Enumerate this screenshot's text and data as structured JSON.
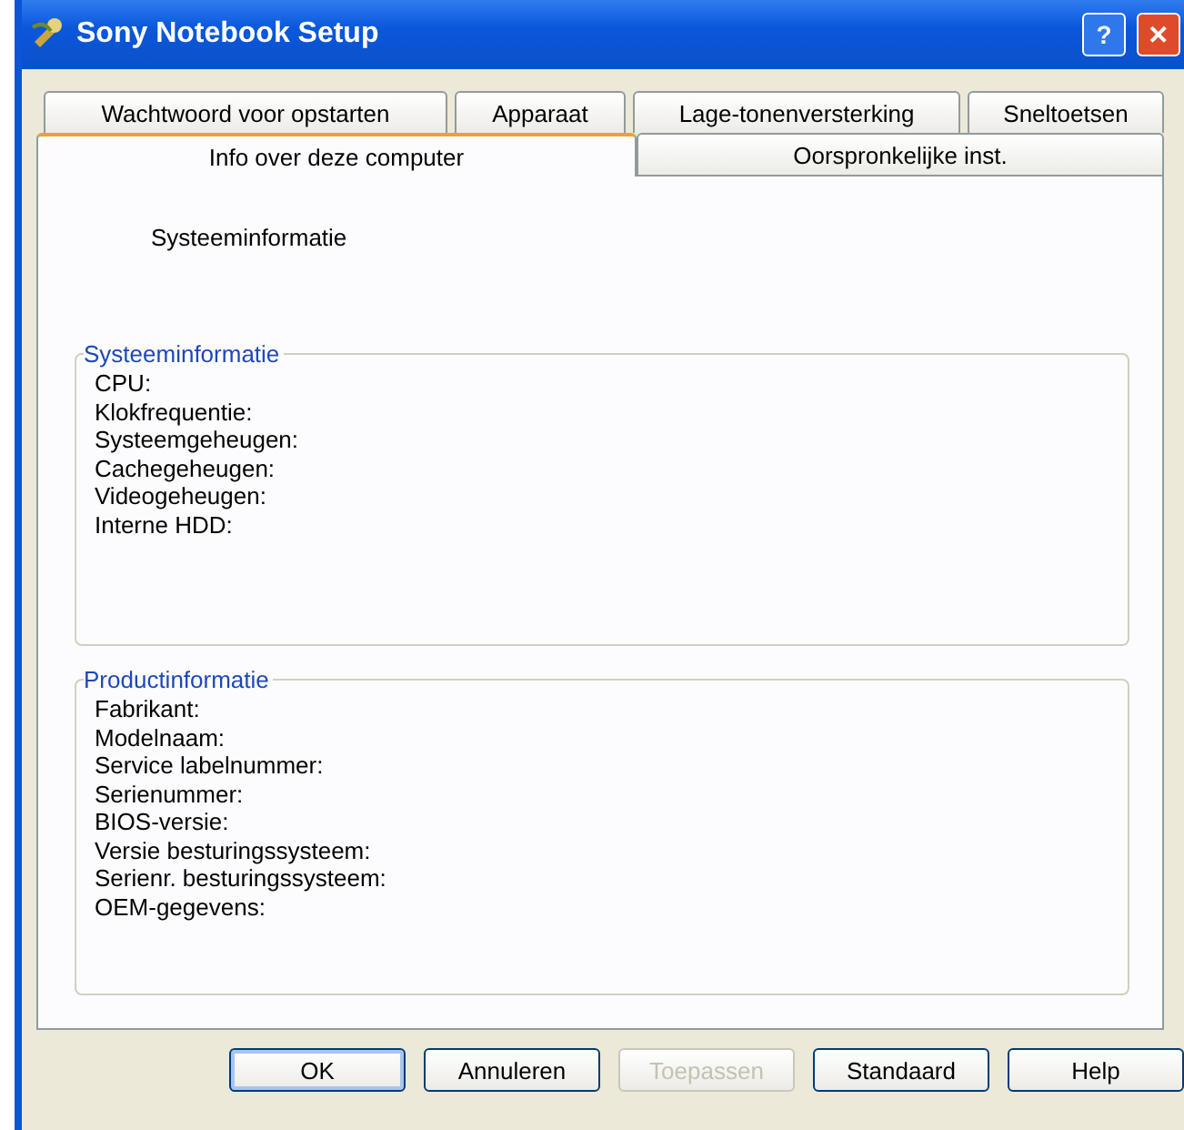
{
  "window": {
    "title": "Sony Notebook Setup",
    "help_button": "?",
    "close_button": "✕"
  },
  "tab_rows": [
    [
      {
        "label": "Wachtwoord voor opstarten",
        "selected": false
      },
      {
        "label": "Apparaat",
        "selected": false
      },
      {
        "label": "Lage-tonenversterking",
        "selected": false
      },
      {
        "label": "Sneltoetsen",
        "selected": false
      }
    ],
    [
      {
        "label": "Info over deze computer",
        "selected": true
      },
      {
        "label": "Oorspronkelijke inst.",
        "selected": false
      }
    ]
  ],
  "heading": "Systeeminformatie",
  "groups": [
    {
      "title": "Systeeminformatie",
      "fields": [
        "CPU:",
        "Klokfrequentie:",
        "Systeemgeheugen:",
        "Cachegeheugen:",
        "Videogeheugen:",
        "Interne HDD:"
      ]
    },
    {
      "title": "Productinformatie",
      "fields": [
        "Fabrikant:",
        "Modelnaam:",
        "Service labelnummer:",
        "Serienummer:",
        "BIOS-versie:",
        "Versie besturingssysteem:",
        "Serienr. besturingssysteem:",
        "OEM-gegevens:"
      ]
    }
  ],
  "buttons": [
    {
      "label": "OK",
      "disabled": false,
      "default": true
    },
    {
      "label": "Annuleren",
      "disabled": false,
      "default": false
    },
    {
      "label": "Toepassen",
      "disabled": true,
      "default": false
    },
    {
      "label": "Standaard",
      "disabled": false,
      "default": false
    },
    {
      "label": "Help",
      "disabled": false,
      "default": false
    }
  ]
}
